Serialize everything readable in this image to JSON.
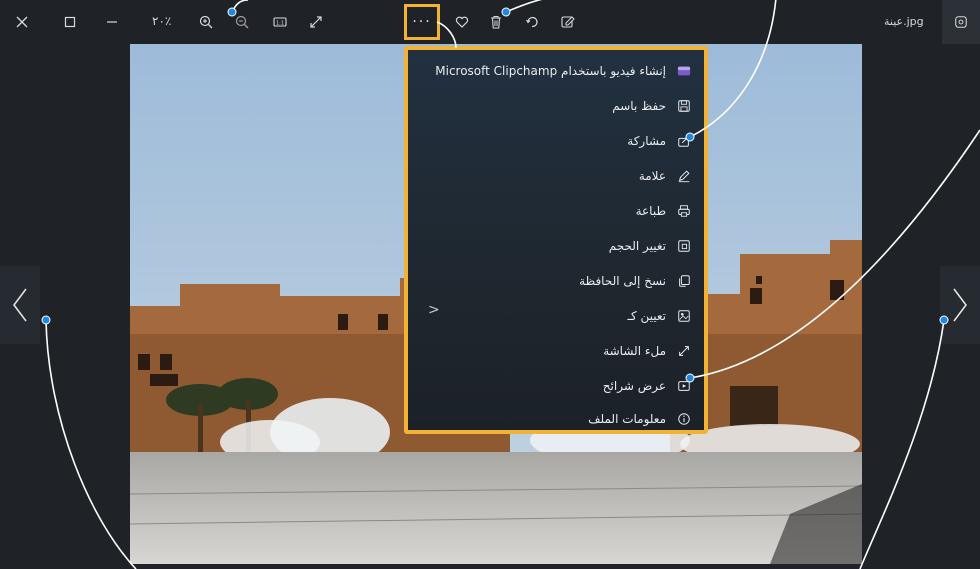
{
  "toolbar": {
    "zoom_level": "٢٠٪",
    "file_name": "عينة.jpg"
  },
  "menu": {
    "items": [
      {
        "label": "إنشاء فيديو باستخدام Microsoft Clipchamp",
        "icon": "clipchamp-icon"
      },
      {
        "label": "حفظ باسم",
        "icon": "save-icon"
      },
      {
        "label": "مشاركة",
        "icon": "share-icon"
      },
      {
        "label": "علامة",
        "icon": "pen-icon"
      },
      {
        "label": "طباعة",
        "icon": "print-icon"
      },
      {
        "label": "تغيير الحجم",
        "icon": "resize-icon"
      },
      {
        "label": "نسخ إلى الحافظة",
        "icon": "copy-icon"
      },
      {
        "label": "تعيين كـ",
        "icon": "set-as-icon"
      },
      {
        "label": "ملء الشاشة",
        "icon": "fullscreen-icon"
      },
      {
        "label": "عرض شرائح",
        "icon": "slideshow-icon"
      },
      {
        "label": "معلومات الملف",
        "icon": "info-icon"
      }
    ]
  },
  "colors": {
    "highlight": "#f2b233",
    "callout_dot": "#1e88e5",
    "background": "#1f2328"
  }
}
